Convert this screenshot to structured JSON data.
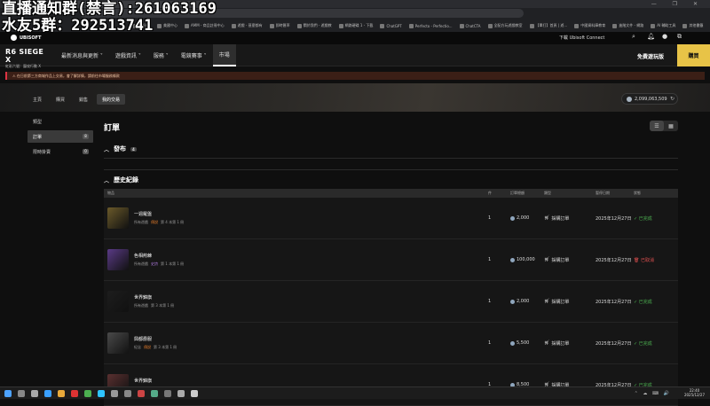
{
  "overlay": {
    "line1": "直播通知群(禁言):261063169",
    "line2": "水友5群：292513741"
  },
  "browser": {
    "bookmarks": [
      "新分頁",
      "美國中心",
      "AMM - 商品註冊中心",
      "遊戲 - 甚麼都有",
      "即時匯率",
      "關於我們 - 遊戲教",
      "網路硬碟 1 - 下載",
      "ChatGPT",
      "Perfecto - Perfectio...",
      "ChatCTA",
      "全配方玩遊戲教室",
      "【單打】首頁 | 遊...",
      "中國資料庫教育",
      "進階文件 - 網路",
      "AI 輔助工具",
      "其他書籤"
    ],
    "window_controls": "— ❐ ✕"
  },
  "site_header": {
    "brand": "UBISOFT",
    "connect_label": "下載 Ubisoft Connect",
    "icons": [
      "search-icon",
      "bell-icon",
      "user-icon",
      "controller-icon"
    ]
  },
  "game_nav": {
    "logo_line1": "R6 SIEGE X",
    "logo_line2": "虹彩六號：圍攻行動 X",
    "items": [
      {
        "label": "最新消息與更新 ˅",
        "active": false
      },
      {
        "label": "遊戲資訊 ˅",
        "active": false
      },
      {
        "label": "服務 ˅",
        "active": false
      },
      {
        "label": "電競賽事 ˅",
        "active": false
      },
      {
        "label": "市場",
        "active": true
      }
    ],
    "free_play": "免費遊玩版",
    "buy": "購買"
  },
  "notice": "⚠ 在日前第三方商城作品上交易，會了解詳情，請前往市場服務條款",
  "subtabs": [
    {
      "label": "主頁",
      "active": false
    },
    {
      "label": "購買",
      "active": false
    },
    {
      "label": "銷售",
      "active": false
    },
    {
      "label": "我的交易",
      "active": true
    }
  ],
  "credits": "2,099,063,509",
  "sidebar": [
    {
      "label": "類型",
      "count": "",
      "active": false
    },
    {
      "label": "訂單",
      "count": "8",
      "active": true
    },
    {
      "label": "限時掛賣",
      "count": "0",
      "active": false
    }
  ],
  "main": {
    "title": "訂單",
    "view_list": "☰",
    "view_grid": "▦",
    "section_published": {
      "title": "發布",
      "count": "4"
    },
    "section_history": {
      "title": "歷史紀錄"
    },
    "columns": [
      "物品",
      "件",
      "訂單總額",
      "類型",
      "暫停日期",
      "狀態"
    ],
    "rows": [
      {
        "name": "一週羅盤",
        "meta1": "所有遊戲",
        "rarity": "傳說",
        "meta2": "第 4 本第 1 冊",
        "qty": "1",
        "price": "2,000",
        "type": "採購訂單",
        "date": "2025年12月27日",
        "status": "已完成",
        "status_ok": true,
        "thumb": "#6b5a2a"
      },
      {
        "name": "色相荊棘",
        "meta1": "所有遊戲",
        "rarity": "史詩",
        "meta2": "第 1 本第 1 冊",
        "qty": "1",
        "price": "100,000",
        "type": "採購訂單",
        "date": "2025年12月27日",
        "status": "已取消",
        "status_ok": false,
        "thumb": "#5a3a86"
      },
      {
        "name": "世界錦旗",
        "meta1": "所有遊戲",
        "rarity": "",
        "meta2": "第 3 本第 1 冊",
        "qty": "1",
        "price": "2,000",
        "type": "採購訂單",
        "date": "2025年12月27日",
        "status": "已完成",
        "status_ok": true,
        "thumb": "#1d1d1d"
      },
      {
        "name": "興都爵服",
        "meta1": "紀念",
        "rarity": "傳說",
        "meta2": "第 3 本第 1 冊",
        "qty": "1",
        "price": "5,500",
        "type": "採購訂單",
        "date": "2025年12月27日",
        "status": "已完成",
        "status_ok": true,
        "thumb": "#4a4a4a"
      },
      {
        "name": "世界錦旗",
        "meta1": "所有遊戲",
        "rarity": "傳說",
        "meta2": "第 3 本第 1 冊",
        "qty": "1",
        "price": "8,500",
        "type": "採購訂單",
        "date": "2025年12月27日",
        "status": "已完成",
        "status_ok": true,
        "thumb": "#5a3030"
      }
    ]
  },
  "taskbar": {
    "time": "22:40",
    "date": "2025/12/27",
    "tray": "⌃ ☁ ⌨ 🔊"
  },
  "colors": {
    "accent_buy": "#e8c347",
    "status_ok": "#4caf50",
    "status_cancel": "#e05050"
  }
}
